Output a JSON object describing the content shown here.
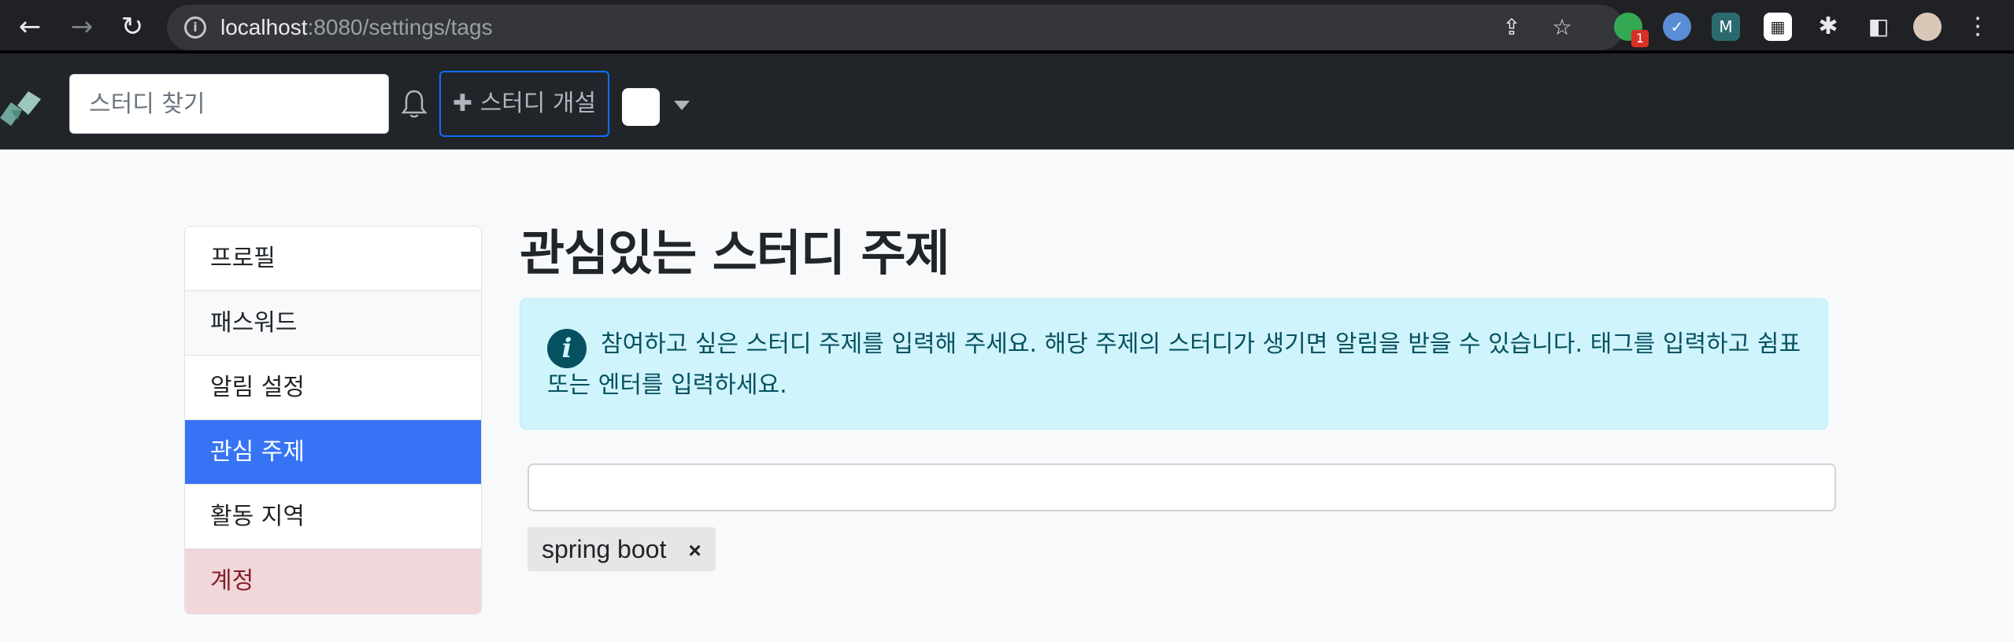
{
  "browser": {
    "url_host": "localhost",
    "url_path": ":8080/settings/tags",
    "extension_badge": "1"
  },
  "navbar": {
    "search_placeholder": "스터디 찾기",
    "create_plus": "✚",
    "create_label": "스터디 개설"
  },
  "sidebar": {
    "items": [
      {
        "label": "프로필"
      },
      {
        "label": "패스워드"
      },
      {
        "label": "알림 설정"
      },
      {
        "label": "관심 주제"
      },
      {
        "label": "활동 지역"
      },
      {
        "label": "계정"
      }
    ]
  },
  "main": {
    "title": "관심있는 스터디 주제",
    "alert_text": "참여하고 싶은 스터디 주제를 입력해 주세요. 해당 주제의 스터디가 생기면 알림을 받을 수 있습니다. 태그를 입력하고 쉼표 또는 엔터를 입력하세요.",
    "tags": [
      {
        "label": "spring boot",
        "remove": "×"
      }
    ]
  },
  "colors": {
    "active": "#3774f5",
    "danger_bg": "#f2d7da",
    "info_bg": "#cff4fc"
  }
}
